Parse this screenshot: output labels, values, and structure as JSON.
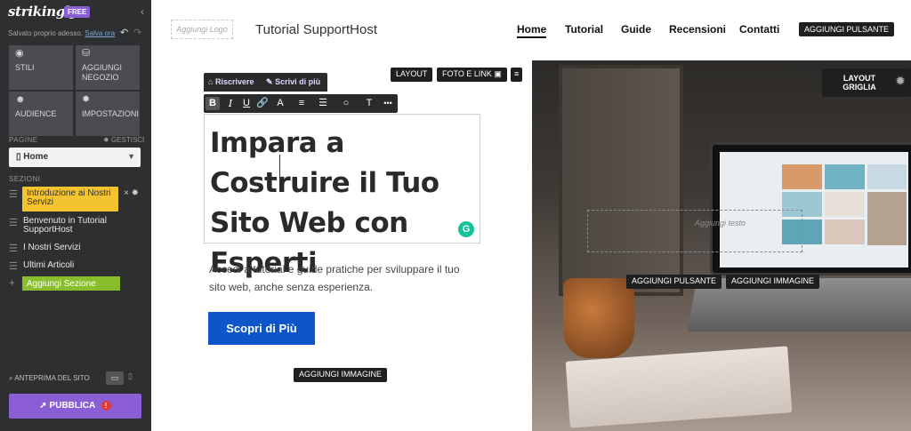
{
  "sidebar": {
    "logo": "strikingly",
    "badge": "FREE",
    "saved_text": "Salvato proprio adesso.",
    "save_now": "Salva ora",
    "tiles": [
      {
        "label": "STILI",
        "icon": "palette-icon"
      },
      {
        "label": "AGGIUNGI NEGOZIO",
        "icon": "store-icon"
      },
      {
        "label": "AUDIENCE",
        "icon": "people-icon"
      },
      {
        "label": "IMPOSTAZIONI",
        "icon": "gear-icon"
      }
    ],
    "pages_label": "PAGINE",
    "manage_label": "GESTISCI",
    "current_page": "Home",
    "sections_label": "SEZIONI",
    "sections": [
      "Introduzione ai Nostri Servizi",
      "Benvenuto in Tutorial SupportHost",
      "I Nostri Servizi",
      "Ultimi Articoli"
    ],
    "add_section": "Aggiungi Sezione",
    "preview_label": "ANTEPRIMA DEL SITO",
    "publish_label": "PUBBLICA",
    "publish_warning": "!"
  },
  "nav": {
    "logo_placeholder": "Aggiungi Logo",
    "site_title": "Tutorial SupportHost",
    "menu": [
      "Home",
      "Tutorial",
      "Guide",
      "Recensioni",
      "Contatti"
    ],
    "add_button": "AGGIUNGI PULSANTE"
  },
  "editor": {
    "layout_button": "LAYOUT",
    "photo_link_button": "FOTO E LINK",
    "ai_rewrite": "Riscrivere",
    "ai_write_more": "Scrivi di più",
    "format_buttons": [
      "B",
      "I",
      "U",
      "🔗",
      "A",
      "≡",
      "☰",
      "○",
      "T",
      "•••"
    ],
    "layout_grid": "LAYOUT GRIGLIA",
    "text_placeholder": "Aggiungi testo",
    "add_button_overlay": "AGGIUNGI PULSANTE",
    "add_image_overlay": "AGGIUNGI IMMAGINE",
    "add_image_bottom": "AGGIUNGI IMMAGINE"
  },
  "hero": {
    "headline": "Impara a Costruire il Tuo Sito Web con Esperti",
    "subtitle": "Accedi a tutorial e guide pratiche per sviluppare il tuo sito web, anche senza esperienza.",
    "cta": "Scopri di Più"
  },
  "colors": {
    "sidebar_bg": "#2e2f31",
    "brand_purple": "#8a5fd6",
    "active_section": "#f4c430",
    "add_section_green": "#88bd2b",
    "cta_blue": "#0d55c8"
  }
}
